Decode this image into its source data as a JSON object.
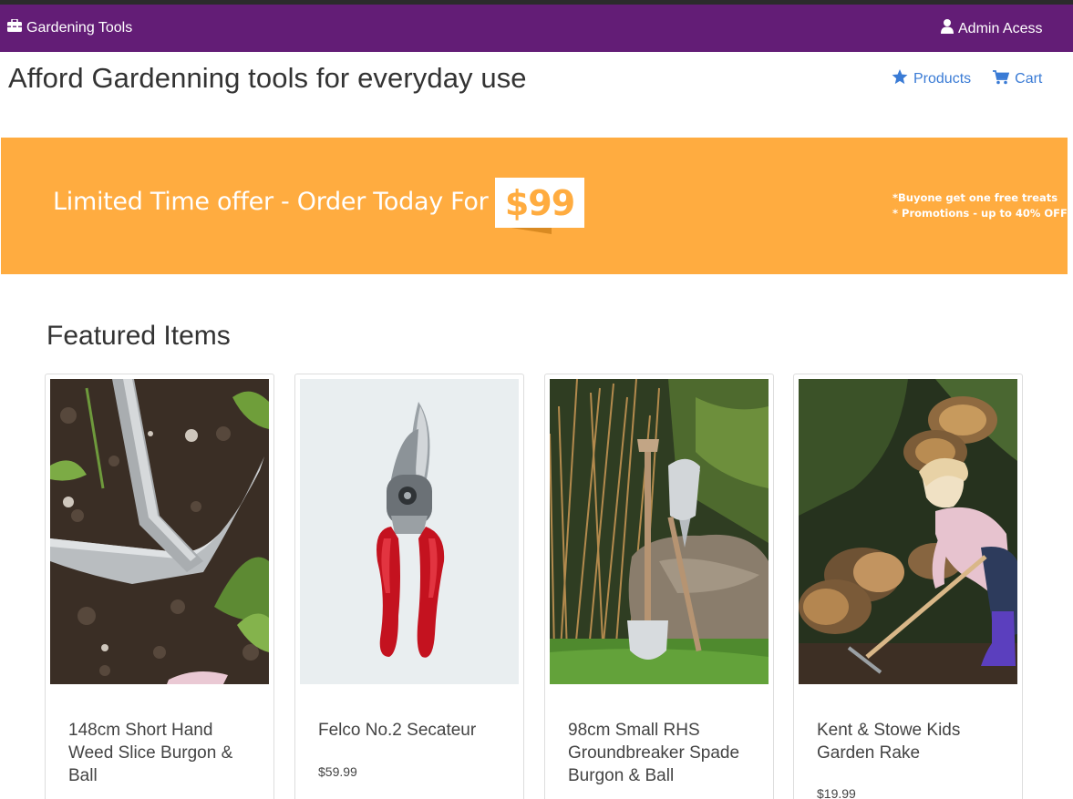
{
  "navbar": {
    "brand": "Gardening Tools",
    "brand_icon": "toolbox-icon",
    "admin": "Admin Acess",
    "admin_icon": "user-icon",
    "background": "#631d76"
  },
  "header": {
    "title": "Afford Gardenning tools for everyday use",
    "links": [
      {
        "label": "Products",
        "icon": "star-icon"
      },
      {
        "label": "Cart",
        "icon": "cart-icon"
      }
    ],
    "link_color": "#3a7bd5"
  },
  "banner": {
    "offer": "Limited Time offer - Order Today For",
    "price": "$99",
    "promos": [
      "*Buyone get one free treats",
      "* Promotions - up to 40% OFF"
    ],
    "background": "#ffac40"
  },
  "featured": {
    "title": "Featured Items",
    "items": [
      {
        "name": "148cm Short Hand Weed Slice Burgon & Ball",
        "price": "",
        "image": "weed-slice-photo"
      },
      {
        "name": "Felco No.2 Secateur",
        "price": "$59.99",
        "image": "secateur-photo"
      },
      {
        "name": "98cm Small RHS Groundbreaker Spade Burgon & Ball",
        "price": "",
        "image": "spade-photo"
      },
      {
        "name": "Kent & Stowe Kids Garden Rake",
        "price": "$19.99",
        "image": "kids-rake-photo"
      }
    ]
  }
}
